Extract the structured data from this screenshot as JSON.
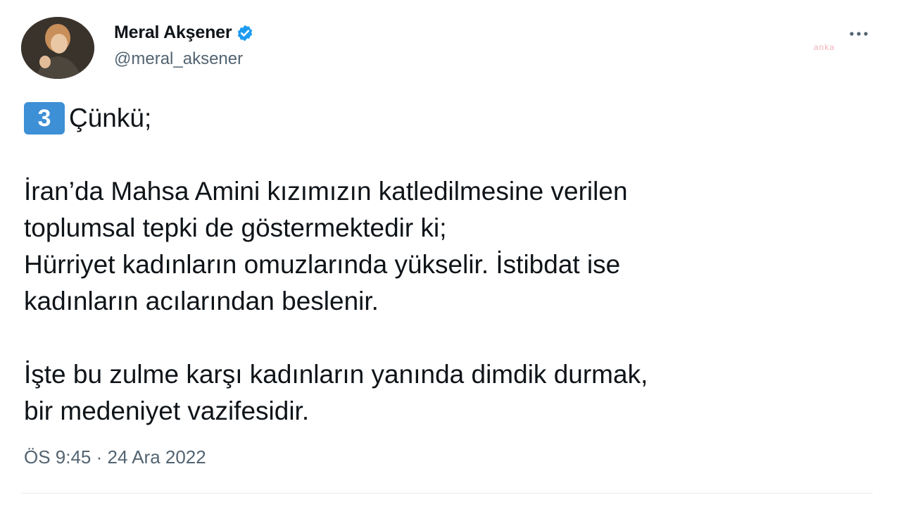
{
  "author": {
    "display_name": "Meral Akşener",
    "handle": "@meral_aksener",
    "verified_icon": "verified-badge-icon",
    "avatar_icon": "avatar"
  },
  "watermark": "anka",
  "tweet": {
    "number_badge": "3",
    "first_line": "Çünkü;",
    "paragraph_1": "İran’da Mahsa Amini kızımızın katledilmesine verilen\ntoplumsal tepki de göstermektedir ki;\nHürriyet kadınların omuzlarında yükselir. İstibdat ise\nkadınların acılarından beslenir.",
    "paragraph_2": "İşte bu zulme karşı kadınların yanında dimdik durmak,\nbir medeniyet vazifesidir."
  },
  "meta": {
    "timestamp": "ÖS 9:45 · 24 Ara 2022"
  },
  "colors": {
    "verified_blue": "#1d9bf0",
    "keycap_blue": "#3d8fd6",
    "secondary_text": "#536471"
  }
}
